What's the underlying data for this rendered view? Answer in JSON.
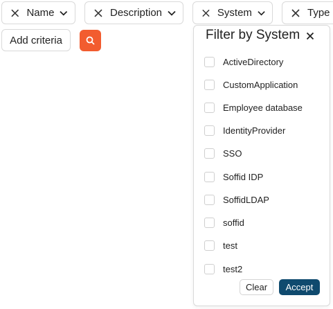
{
  "filters": {
    "name": {
      "label": "Name"
    },
    "description": {
      "label": "Description"
    },
    "system": {
      "label": "System"
    },
    "type": {
      "label": "Type"
    }
  },
  "toolbar": {
    "add_criteria_label": "Add criteria"
  },
  "colors": {
    "search_button": "#f25c2f",
    "accept_button": "#0f4a6e",
    "border": "#d9d9d9"
  },
  "system_filter": {
    "title": "Filter by System",
    "options": [
      {
        "label": "ActiveDirectory",
        "checked": false
      },
      {
        "label": "CustomApplication",
        "checked": false
      },
      {
        "label": "Employee database",
        "checked": false
      },
      {
        "label": "IdentityProvider",
        "checked": false
      },
      {
        "label": "SSO",
        "checked": false
      },
      {
        "label": "Soffid IDP",
        "checked": false
      },
      {
        "label": "SoffidLDAP",
        "checked": false
      },
      {
        "label": "soffid",
        "checked": false
      },
      {
        "label": "test",
        "checked": false
      },
      {
        "label": "test2",
        "checked": false
      }
    ],
    "clear_label": "Clear",
    "accept_label": "Accept"
  }
}
